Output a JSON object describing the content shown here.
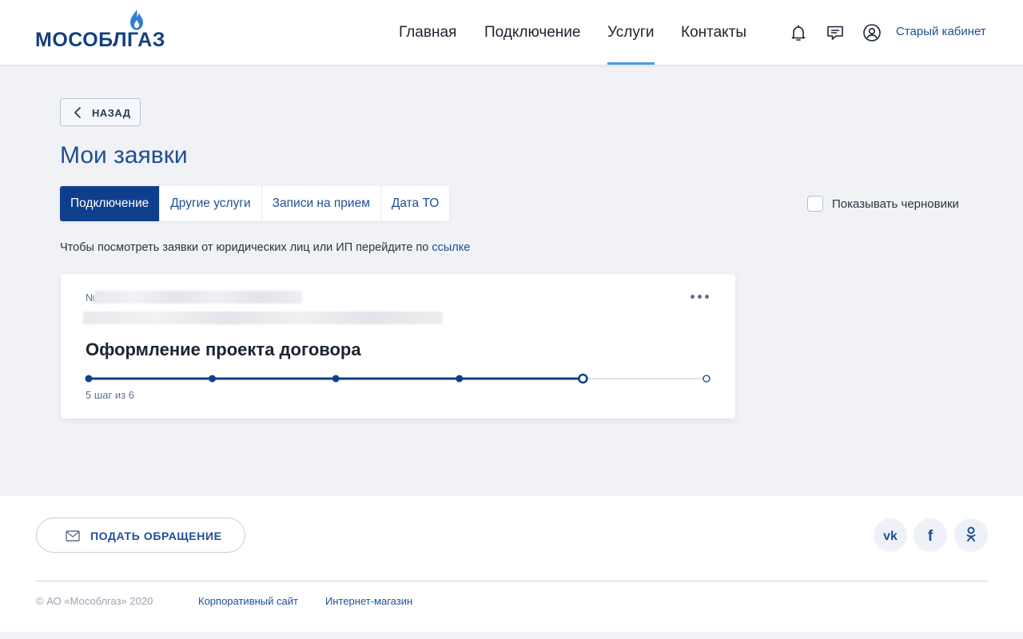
{
  "header": {
    "logo_text": "МОСОБЛГАЗ",
    "nav": [
      {
        "label": "Главная"
      },
      {
        "label": "Подключение"
      },
      {
        "label": "Услуги",
        "active": true
      },
      {
        "label": "Контакты"
      }
    ],
    "icons": [
      "bell-icon",
      "chat-icon",
      "user-icon"
    ],
    "old_cabinet": "Старый кабинет"
  },
  "main": {
    "back_label": "НАЗАД",
    "title": "Мои заявки",
    "tabs": [
      {
        "label": "Подключение",
        "active": true
      },
      {
        "label": "Другие услуги"
      },
      {
        "label": "Записи на прием"
      },
      {
        "label": "Дата ТО"
      }
    ],
    "show_drafts_label": "Показывать черновики",
    "show_drafts_checked": false,
    "notice_text": "Чтобы посмотреть заявки от юридических лиц или ИП перейдите по ",
    "notice_link": "ссылке"
  },
  "request_card": {
    "number_prefix": "№",
    "status": "Оформление проекта договора",
    "current_step": 5,
    "total_steps": 6,
    "steps_label": "5 шаг из 6"
  },
  "footer": {
    "appeal_label": "ПОДАТЬ ОБРАЩЕНИЕ",
    "social": [
      {
        "name": "vk-icon",
        "glyph": "vk"
      },
      {
        "name": "facebook-icon",
        "glyph": "f"
      },
      {
        "name": "odnoklassniki-icon",
        "glyph": "ok"
      }
    ],
    "copyright": "© АО «Мособлгаз» 2020",
    "links": [
      {
        "label": "Корпоративный сайт"
      },
      {
        "label": "Интернет-магазин"
      }
    ]
  },
  "colors": {
    "brand": "#14417f",
    "accent": "#0f3f8c",
    "link": "#1f4f96",
    "nav_underline": "#4a9be0",
    "background": "#f0f2f6"
  }
}
